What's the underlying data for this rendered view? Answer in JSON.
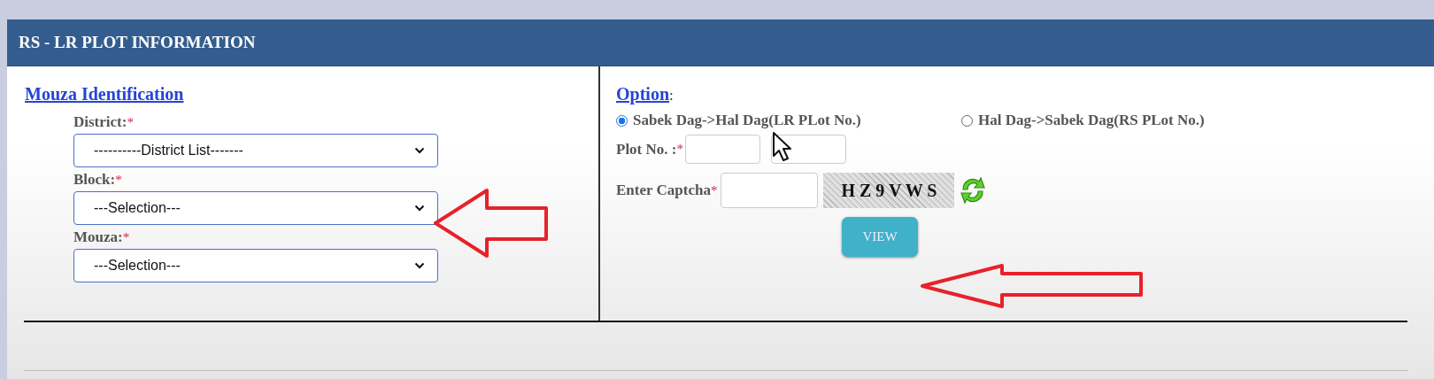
{
  "panel": {
    "title": "RS - LR PLOT INFORMATION"
  },
  "mouza_identification": {
    "heading": "Mouza Identification",
    "fields": [
      {
        "label": "District:",
        "required_mark": "*",
        "value": "----------District List-------"
      },
      {
        "label": "Block:",
        "required_mark": "*",
        "value": "---Selection---"
      },
      {
        "label": "Mouza:",
        "required_mark": "*",
        "value": "---Selection---"
      }
    ]
  },
  "option": {
    "heading": "Option",
    "colon": ":",
    "radios": [
      {
        "label": "Sabek Dag->Hal Dag(LR PLot No.)",
        "selected": true
      },
      {
        "label": "Hal Dag->Sabek Dag(RS PLot No.)",
        "selected": false
      }
    ],
    "plot_no": {
      "label": "Plot No. :",
      "required_mark": "*"
    },
    "captcha": {
      "label": "Enter Captcha",
      "required_mark": "*",
      "code": "H Z 9 V W S"
    },
    "button": "VIEW"
  }
}
